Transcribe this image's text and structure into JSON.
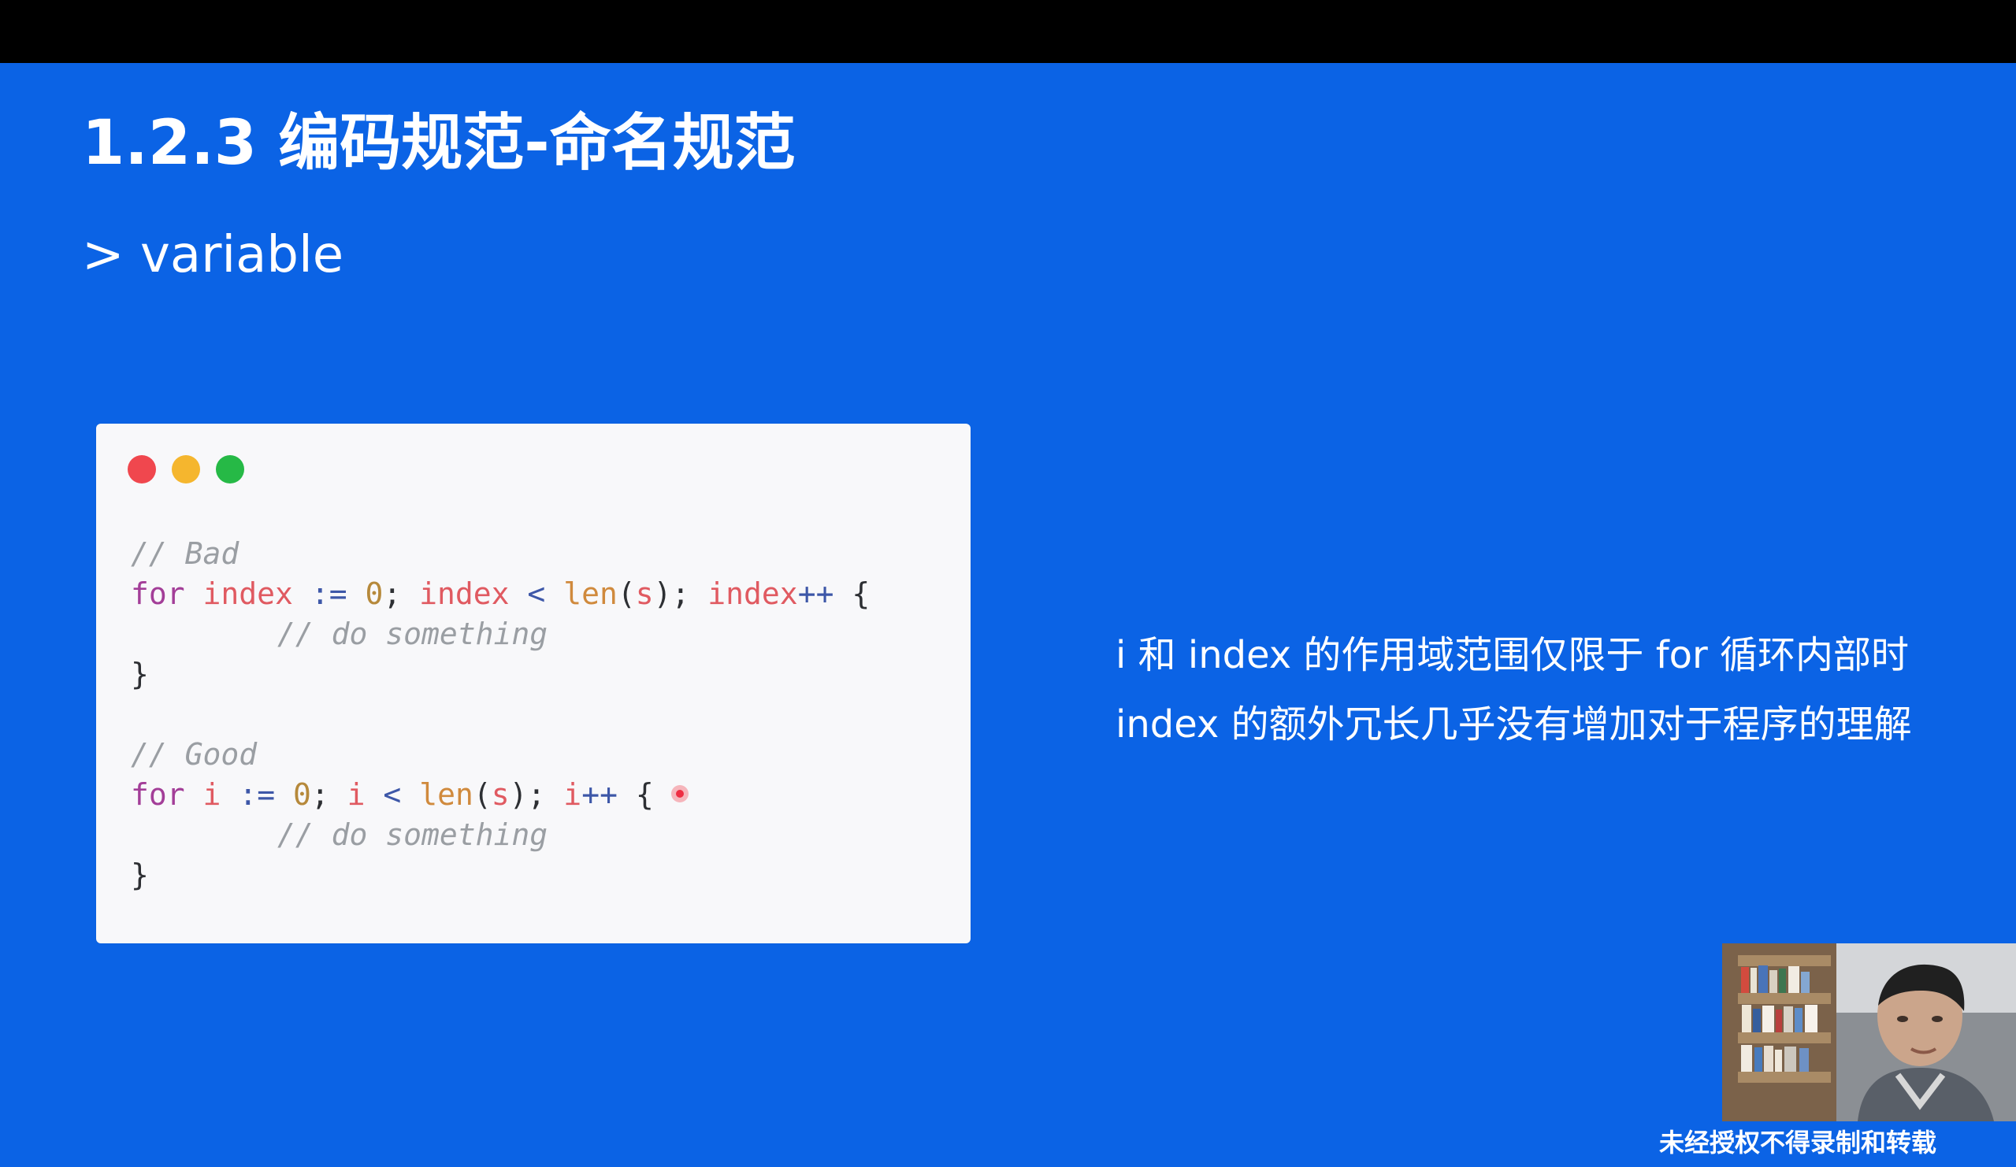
{
  "slide": {
    "title": "1.2.3 编码规范-命名规范",
    "section_label": "> variable",
    "code_card": {
      "bad_comment": "// Bad",
      "bad_loop": {
        "keyword": "for",
        "var": "index",
        "assign": ":=",
        "zero": "0",
        "semi1": ";",
        "var2": "index",
        "lt": "<",
        "len": "len",
        "open_paren": "(",
        "arg": "s",
        "close_paren": ")",
        "semi2": ";",
        "var3": "index",
        "inc": "++",
        "brace": "{"
      },
      "bad_body_comment": "// do something",
      "bad_close": "}",
      "good_comment": "// Good",
      "good_loop": {
        "keyword": "for",
        "var": "i",
        "assign": ":=",
        "zero": "0",
        "semi1": ";",
        "var2": "i",
        "lt": "<",
        "len": "len",
        "open_paren": "(",
        "arg": "s",
        "close_paren": ")",
        "semi2": ";",
        "var3": "i",
        "inc": "++",
        "brace": "{"
      },
      "good_body_comment": "// do something",
      "good_close": "}"
    },
    "explanation": {
      "line1": "i 和 index 的作用域范围仅限于 for 循环内部时",
      "line2": "index 的额外冗长几乎没有增加对于程序的理解"
    },
    "watermark": "未经授权不得录制和转载"
  },
  "colors": {
    "background": "#0b63e5",
    "card": "#f8f8fa",
    "dot_red": "#f0474e",
    "dot_yellow": "#f5b62e",
    "dot_green": "#26b946"
  },
  "icons": {
    "window_close": "red-dot-icon",
    "window_minimize": "yellow-dot-icon",
    "window_maximize": "green-dot-icon",
    "cursor": "laser-pointer-icon"
  }
}
